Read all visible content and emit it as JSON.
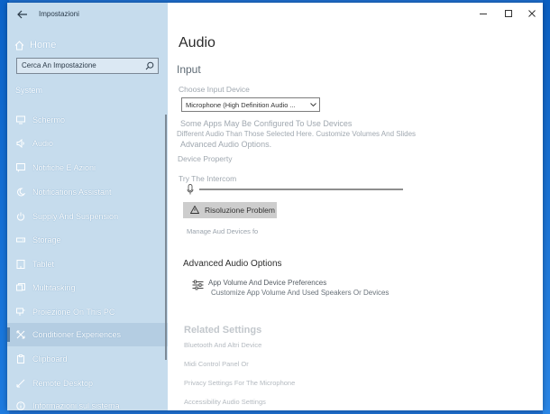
{
  "app": {
    "title": "Impostazioni"
  },
  "sidebar": {
    "home_label": "Home",
    "search_value": "Cerca An Impostazione",
    "section_label": "System",
    "items": [
      {
        "label": "Schermo",
        "icon": "monitor-icon"
      },
      {
        "label": "Audio",
        "icon": "speaker-icon"
      },
      {
        "label": "Notifiche E Azioni",
        "icon": "notification-icon"
      },
      {
        "label": "Notifications Assistant",
        "icon": "moon-icon"
      },
      {
        "label": "Supply And Suspension",
        "icon": "power-icon"
      },
      {
        "label": "Storage",
        "icon": "storage-icon"
      },
      {
        "label": "Tablet",
        "icon": "tablet-icon"
      },
      {
        "label": "Multitasking",
        "icon": "multitasking-icon"
      },
      {
        "label": "Proiezione On This PC",
        "icon": "projection-icon"
      },
      {
        "label": "Conditioner Experiences",
        "icon": "shared-experiences-icon"
      },
      {
        "label": "Clipboard",
        "icon": "clipboard-icon"
      },
      {
        "label": "Remote Desktop",
        "icon": "remote-desktop-icon"
      },
      {
        "label": "Informazioni sul sistema",
        "icon": "info-icon"
      }
    ]
  },
  "main": {
    "title": "Audio",
    "input_heading": "Input",
    "choose_device_label": "Choose Input Device",
    "device_value": "Microphone (High Definition Audio ...",
    "note_line1": "Some Apps May Be Configured To Use Devices",
    "note_line2": "Different Audio Than Those Selected Here. Customize Volumes And Slides",
    "note_line3": "Advanced Audio Options.",
    "device_properties": "Device Property",
    "test_label": "Try The Intercom",
    "troubleshoot_label": "Risoluzione Problem",
    "manage_devices": "Manage Aud Devices fo",
    "advanced_heading": "Advanced Audio Options",
    "advanced_item_title": "App Volume And Device Preferences",
    "advanced_item_desc": "Customize App Volume And Used Speakers Or Devices",
    "related_heading": "Related Settings",
    "related_links": [
      "Bluetooth And Altri Device",
      "Midi Control Panel Or",
      "Privacy Settings For The Microphone",
      "Accessibility Audio Settings"
    ]
  },
  "colors": {
    "sidebar_bg": "#c6dced",
    "selected_bg": "#b4cde2",
    "desktop": "#1e6fd0"
  }
}
